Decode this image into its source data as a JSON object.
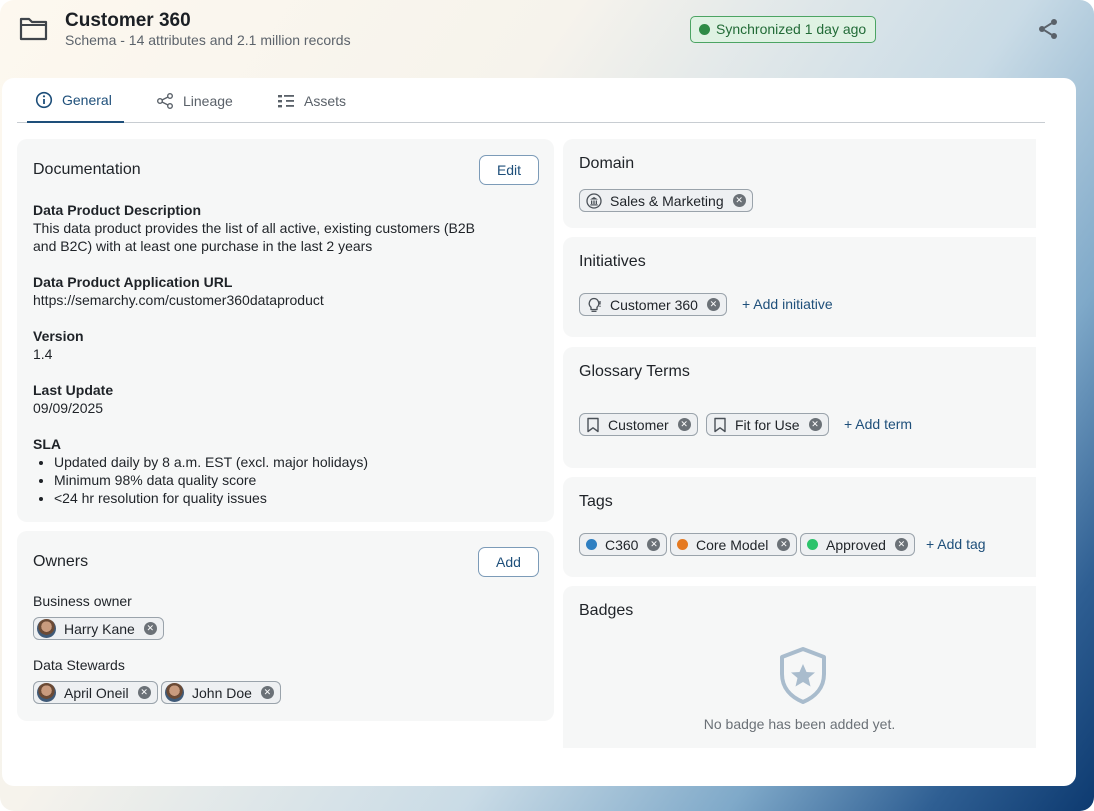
{
  "header": {
    "title": "Customer 360",
    "subtitle": "Schema - 14 attributes and 2.1 million records",
    "sync_status": "Synchronized 1 day ago"
  },
  "tabs": [
    {
      "label": "General",
      "active": true
    },
    {
      "label": "Lineage",
      "active": false
    },
    {
      "label": "Assets",
      "active": false
    }
  ],
  "documentation": {
    "title": "Documentation",
    "edit_label": "Edit",
    "description_label": "Data Product Description",
    "description_line1": "This data product provides the list of all active, existing customers (B2B",
    "description_line2": "and B2C) with at least one purchase in the last 2 years",
    "url_label": "Data Product Application URL",
    "url_value": "https://semarchy.com/customer360dataproduct",
    "version_label": "Version",
    "version_value": "1.4",
    "last_update_label": "Last Update",
    "last_update_value": "09/09/2025",
    "sla_label": "SLA",
    "sla_items": [
      "Updated daily by 8 a.m. EST (excl. major holidays)",
      "Minimum 98% data quality score",
      "<24 hr resolution for quality issues"
    ]
  },
  "owners": {
    "title": "Owners",
    "add_label": "Add",
    "business_owner_label": "Business owner",
    "business_owners": [
      "Harry Kane"
    ],
    "stewards_label": "Data Stewards",
    "stewards": [
      "April Oneil",
      "John Doe"
    ]
  },
  "domain": {
    "title": "Domain",
    "value": "Sales & Marketing"
  },
  "initiatives": {
    "title": "Initiatives",
    "items": [
      "Customer 360"
    ],
    "add_label": "+ Add initiative"
  },
  "glossary": {
    "title": "Glossary Terms",
    "items": [
      "Customer",
      "Fit for Use"
    ],
    "add_label": "+ Add term"
  },
  "tags": {
    "title": "Tags",
    "items": [
      {
        "label": "C360",
        "color": "#2f7fc1"
      },
      {
        "label": "Core Model",
        "color": "#e57a22"
      },
      {
        "label": "Approved",
        "color": "#2cc36b"
      }
    ],
    "add_label": "+ Add tag"
  },
  "badges": {
    "title": "Badges",
    "empty_text": "No badge has been added yet."
  },
  "colors": {
    "accent": "#1e4f7a",
    "sync_green": "#2e8b46"
  }
}
